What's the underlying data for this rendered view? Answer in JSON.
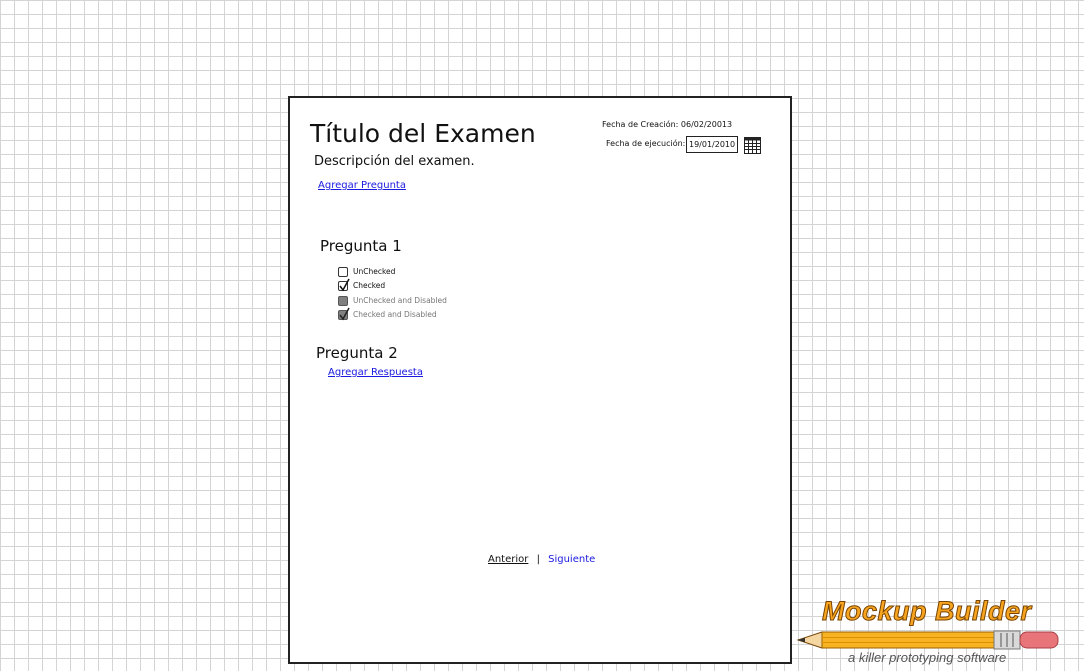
{
  "exam": {
    "title": "Título del Examen",
    "description": "Descripción del examen.",
    "add_question_link": "Agregar Pregunta"
  },
  "meta": {
    "creation_label": "Fecha de Creación:",
    "creation_date": "06/02/20013",
    "execution_label": "Fecha de ejecución:",
    "execution_date": "19/01/2010"
  },
  "questions": [
    {
      "title": "Pregunta 1",
      "options": [
        {
          "label": "UnChecked",
          "checked": false,
          "disabled": false
        },
        {
          "label": "Checked",
          "checked": true,
          "disabled": false
        },
        {
          "label": "UnChecked and Disabled",
          "checked": false,
          "disabled": true
        },
        {
          "label": "Checked and Disabled",
          "checked": true,
          "disabled": true
        }
      ]
    },
    {
      "title": "Pregunta 2",
      "add_answer_link": "Agregar Respuesta"
    }
  ],
  "nav": {
    "prev": "Anterior",
    "separator": "|",
    "next": "Siguiente"
  },
  "branding": {
    "name": "Mockup Builder",
    "tagline": "a killer prototyping software",
    "colors": {
      "accent": "#f7a51f",
      "link": "#1a1ae0"
    },
    "icon": "pencil-icon"
  }
}
